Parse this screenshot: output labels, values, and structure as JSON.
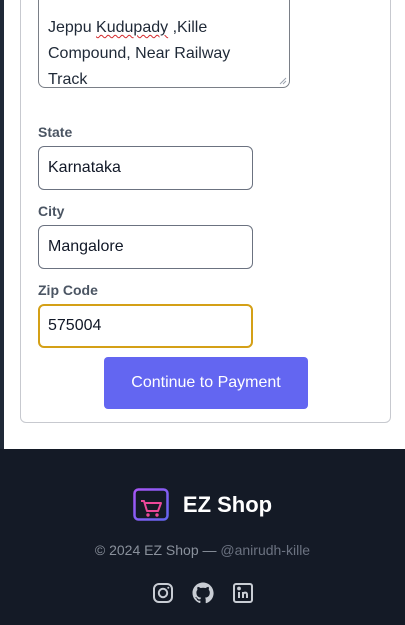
{
  "address": {
    "line1_part1": "Jeppu",
    "line1_part2": "Kudupady",
    "line1_part3": ",Kille",
    "line2": "Compound, Near Railway",
    "line3": "Track"
  },
  "state": {
    "label": "State",
    "value": "Karnataka"
  },
  "city": {
    "label": "City",
    "value": "Mangalore"
  },
  "zip": {
    "label": "Zip Code",
    "value": "575004"
  },
  "continue_button": {
    "label": "Continue to Payment"
  },
  "footer": {
    "brand_name": "EZ Shop",
    "copyright_prefix": "© 2024 EZ Shop — ",
    "handle": "@anirudh-kille",
    "social_icons": [
      "instagram-icon",
      "github-icon",
      "linkedin-icon"
    ]
  },
  "colors": {
    "accent": "#6366f1",
    "footer_bg": "#141a26",
    "focus_border": "#d4a017",
    "brand_icon": "#a855f7"
  }
}
